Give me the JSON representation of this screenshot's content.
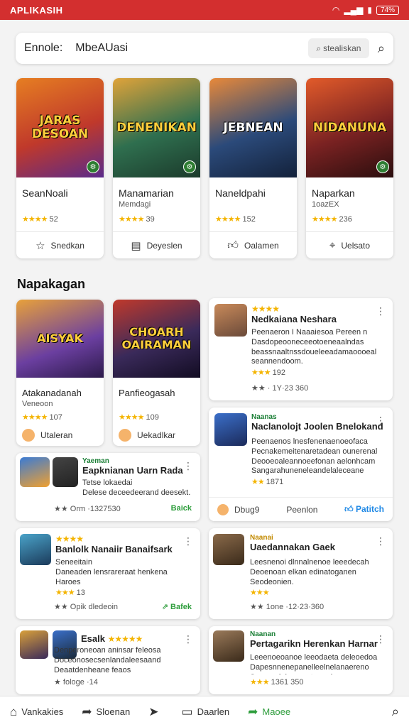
{
  "status": {
    "app": "APLIKASIH",
    "battery": "74%"
  },
  "search": {
    "label": "Ennole:",
    "query": "MbeAUasi",
    "chip": "stealiskan"
  },
  "top_games": [
    {
      "art": "JARAS DESOAN",
      "name": "SeanNoali",
      "sub": "",
      "stars": "★★★★",
      "count": "52",
      "action": "Snedkan",
      "icon": "star-icon",
      "bg": "#c0392b"
    },
    {
      "art": "DENENIKAN",
      "name": "Manamarian",
      "sub": "Memdagi",
      "stars": "★★★★",
      "count": "39",
      "action": "Deyeslen",
      "icon": "note-icon",
      "bg": "#2f6f4f"
    },
    {
      "art": "JEBNEAN",
      "name": "Naneldpahi",
      "sub": "",
      "stars": "★★★★",
      "count": "152",
      "action": "Oalamen",
      "icon": "thumb-icon",
      "bg": "#2b4a7a"
    },
    {
      "art": "NIDANUNA",
      "name": "Naparkan",
      "sub": "1oazEX",
      "stars": "★★★★",
      "count": "236",
      "action": "Uelsato",
      "icon": "tag-icon",
      "bg": "#7a2222"
    }
  ],
  "section": {
    "title": "Napakagan"
  },
  "section_games": [
    {
      "art": "AISYAK",
      "name": "Atakanadanah",
      "sub": "Veneoon",
      "stars": "★★★★",
      "count": "107",
      "foot": "Utaleran",
      "bg": "#6b3fa0"
    },
    {
      "art": "CHOARH OAIRAMAN",
      "name": "Panfieogasah",
      "sub": "",
      "stars": "★★★★",
      "count": "109",
      "foot": "Uekadlkar",
      "bg": "#3a2a5a"
    }
  ],
  "reviews": {
    "r1": {
      "stars": "★★★★",
      "title": "Nedkaiana Neshara",
      "body": "Peenaeron I Naaaiesoa Pereen n Dasdopeooneceeotoeneaalndas beassnaaltnssdoueleeadamaoooeal seannendoom.",
      "rating": "★★★",
      "count": "192",
      "meta": "★★  · 1Y·23 360"
    },
    "r2": {
      "tag": "Naanas",
      "title": "Naclanolojt Joolen Bnelokand",
      "body": "Peenaenos lnesfenenaenoeofaca Pecnakemeitenaretadean ounerenal Deooeoaleannoeefonan aelonhcam Sangarahuneneleandelaleceane Dunonpesoes.",
      "rating": "★★",
      "count": "1871",
      "foot_left": "Dbug9",
      "foot_mid": "Peenlon",
      "foot_right": "Patitch"
    },
    "r3": {
      "tag": "Yaeman",
      "title": "Eapknianan Uarn Rada",
      "body1": "Tetse lokaedai",
      "body2": "Delese deceedeerand deesekt.",
      "meta": "★★  Orm ·1327530",
      "right": "Baick"
    },
    "r4": {
      "stars": "★★★★",
      "title": "Banlolk Nanaiir Banaifsark",
      "body1": "Seneeitain",
      "body2": "Daneaden lensrareraat henkena Haroes",
      "rating": "★★★",
      "count": "13",
      "meta": "★★  Opik dledeoin",
      "right": "Bafek"
    },
    "r5": {
      "tag": "Naanai",
      "title": "Uaedannakan Gaek",
      "body": "Leesnenoi dlnnalnenoe leeedecah Deoenoan elkan edinatoganen Seodeonien.",
      "rating": "★★★",
      "count": "",
      "meta": "★★  1one ·12·23·360"
    },
    "r6": {
      "title": "Esalk",
      "stars": "★★★★★",
      "body": "Denperoneoan aninsar feleosa Doceonosecsenlandaleesaand Deaatdenheane feaos",
      "meta": "★  fologe ·14"
    },
    "r7": {
      "tag": "Naanan",
      "title": "Pertagarikn Herenkan Harnar",
      "body": "Leeenoeoanoe leeodaeta deleoedoa Dapesnnenepanelleelnelanaereno Seconadelen eeatmnedeeneoe",
      "rating": "★★★",
      "count": "1361 350"
    }
  },
  "nav": [
    {
      "label": "Vankakies",
      "icon": "home-icon"
    },
    {
      "label": "Sloenan",
      "icon": "share-icon"
    },
    {
      "label": "",
      "icon": "send-icon"
    },
    {
      "label": "Daarlen",
      "icon": "chat-icon"
    },
    {
      "label": "Maoee",
      "icon": "share-icon-green"
    }
  ],
  "colors": {
    "statusbar": "#d32f2f",
    "accent_green": "#2e9d3c",
    "star": "#f4b400"
  }
}
